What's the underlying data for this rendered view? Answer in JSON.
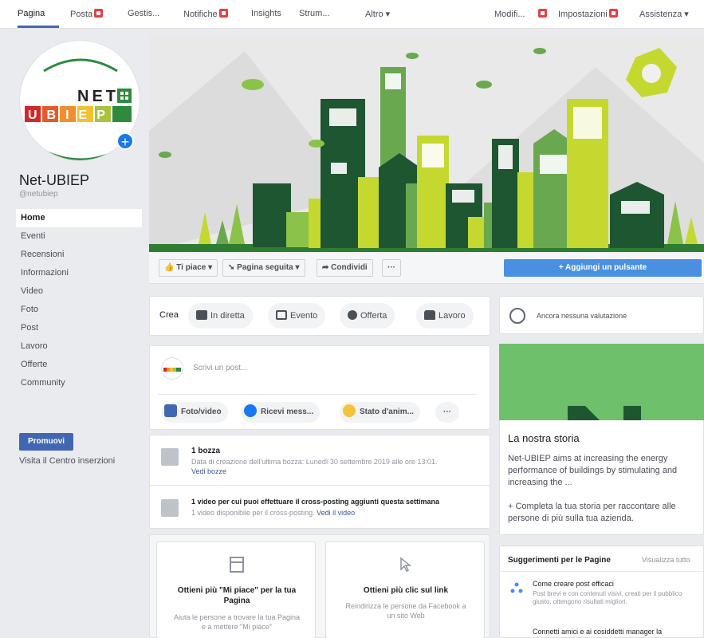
{
  "nav": {
    "items": [
      {
        "label": "Pagina",
        "active": true,
        "badge": false
      },
      {
        "label": "Posta",
        "active": false,
        "badge": true
      },
      {
        "label": "Gestis...",
        "active": false,
        "badge": false
      },
      {
        "label": "Notifiche",
        "active": false,
        "badge": true
      },
      {
        "label": "Insights",
        "active": false,
        "badge": false
      },
      {
        "label": "Strum...",
        "active": false,
        "badge": false
      },
      {
        "label": "Altro ▾",
        "active": false,
        "badge": false
      },
      {
        "label": "Modifi...",
        "active": false,
        "badge": true
      },
      {
        "label": "Impostazioni",
        "active": false,
        "badge": true
      },
      {
        "label": "Assistenza ▾",
        "active": false,
        "badge": false
      }
    ]
  },
  "logo": {
    "line1": "NET",
    "line2": "UBIEP"
  },
  "page": {
    "name": "Net-UBIEP",
    "handle": "@netubiep"
  },
  "sidebar": {
    "items": [
      {
        "label": "Home",
        "active": true
      },
      {
        "label": "Eventi"
      },
      {
        "label": "Recensioni"
      },
      {
        "label": "Informazioni"
      },
      {
        "label": "Video"
      },
      {
        "label": "Foto"
      },
      {
        "label": "Post"
      },
      {
        "label": "Lavoro"
      },
      {
        "label": "Offerte"
      },
      {
        "label": "Community"
      }
    ],
    "promote_label": "Promuovi",
    "ads_link": "Visita il Centro inserzioni"
  },
  "actions": {
    "like": "👍 Ti piace ▾",
    "follow": "➘ Pagina seguita ▾",
    "share": "➦ Condividi",
    "more": "···",
    "add_button": "+ Aggiungi un pulsante"
  },
  "create": {
    "label": "Crea",
    "items": [
      "In diretta",
      "Evento",
      "Offerta",
      "Lavoro"
    ]
  },
  "composer": {
    "placeholder": "Scrivi un post...",
    "buttons": [
      "Foto/video",
      "Ricevi mess...",
      "Stato d'anim..."
    ],
    "more": "···"
  },
  "drafts": {
    "title": "1 bozza",
    "text": "Data di creazione dell'ultima bozza: Lunedì 30 settembre 2019 alle ore 13:01.",
    "link": "Vedi bozze"
  },
  "crosspost": {
    "title": "1 video per cui puoi effettuare il cross-posting aggiunti questa settimana",
    "text": "1 video disponibile per il cross-posting.",
    "link": "Vedi il video"
  },
  "promo_cards": [
    {
      "title": "Ottieni più \"Mi piace\" per la tua Pagina",
      "text": "Aiuta le persone a trovare la tua Pagina e a mettere \"Mi piace\""
    },
    {
      "title": "Ottieni più clic sul link",
      "text": "Reindirizza le persone da Facebook a un sito Web"
    }
  ],
  "rating": {
    "text": "Ancora nessuna valutazione"
  },
  "story": {
    "title": "La nostra storia",
    "body": "Net-UBIEP aims at increasing the energy performance of buildings by stimulating and increasing the ...",
    "cta": "+ Completa la tua storia per raccontare alle persone di più sulla tua azienda."
  },
  "suggestions": {
    "title": "Suggerimenti per le Pagine",
    "link": "Visualizza tutto",
    "items": [
      {
        "title": "Come creare post efficaci",
        "text": "Post brevi e con contenuti visivi, creati per il pubblico giusto, ottengono risultati migliori."
      },
      {
        "title": "Connetti amici e ai cosiddetti manager la",
        "text": ""
      }
    ]
  },
  "colors": {
    "brand_blue": "#4267b2",
    "button_blue": "#4a90e2",
    "leaf_green": "#6ec06a",
    "dark_green": "#1e5631",
    "lime": "#c5d82f"
  }
}
